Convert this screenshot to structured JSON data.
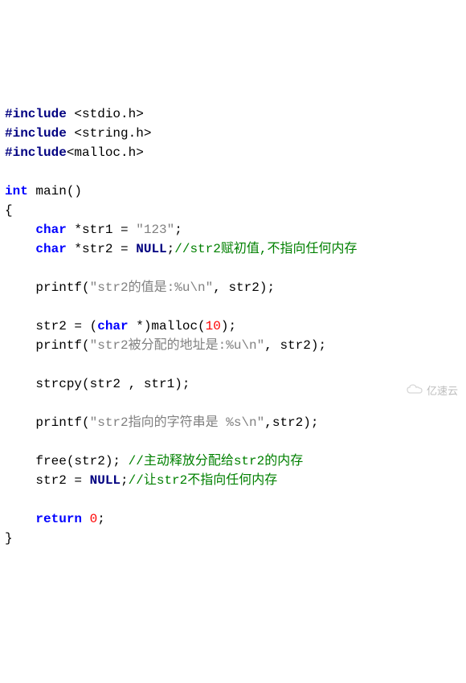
{
  "code": {
    "kw_include": "#include",
    "hdr_stdio": "<stdio.h>",
    "hdr_string": "<string.h>",
    "hdr_malloc": "<malloc.h>",
    "kw_int": "int",
    "fn_main": "main()",
    "brace_open": "{",
    "brace_close": "}",
    "kw_char": "char",
    "decl_str1": " *str1 = ",
    "lit_123": "\"123\"",
    "semi": ";",
    "decl_str2": " *str2 = ",
    "kw_null_1": "NULL",
    "cmt_str2_init": "//str2赋初值,不指向任何内存",
    "call_printf_val": "printf(",
    "lit_printf_val": "\"str2的值是:%u\\n\"",
    "args_printf_val": ", str2);",
    "assign_str2": "str2 = (",
    "cast_char": " *)malloc(",
    "lit_10": "10",
    "close_malloc": ");",
    "call_printf_addr": "printf(",
    "lit_printf_addr": "\"str2被分配的地址是:%u\\n\"",
    "args_printf_addr": ", str2);",
    "call_strcpy": "strcpy(str2 , str1);",
    "call_printf_str": "printf(",
    "lit_printf_str": "\"str2指向的字符串是 %s\\n\"",
    "cursor_bar": "|",
    "args_printf_str": ",str2);",
    "call_free": "free(str2); ",
    "cmt_free": "//主动释放分配给str2的内存",
    "assign_null": "str2 = ",
    "kw_null_2": "NULL",
    "cmt_null": "//让str2不指向任何内存",
    "kw_return": "return",
    "sp": " ",
    "lit_0": "0"
  },
  "watermark": "亿速云"
}
